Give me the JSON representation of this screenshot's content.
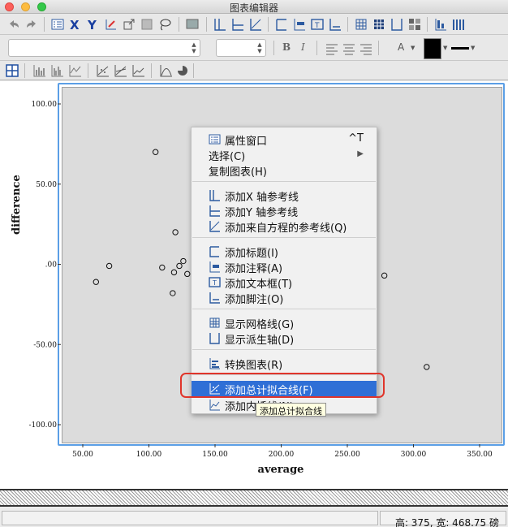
{
  "window": {
    "title": "图表编辑器"
  },
  "chart_data": {
    "type": "scatter",
    "xlabel": "average",
    "ylabel": "difference",
    "xlim": [
      30,
      360
    ],
    "ylim": [
      -115,
      115
    ],
    "x_ticks": [
      50,
      100,
      150,
      200,
      250,
      300,
      350
    ],
    "x_tick_labels": [
      "50.00",
      "100.00",
      "150.00",
      "200.00",
      "250.00",
      "300.00",
      "350.00"
    ],
    "y_ticks": [
      100,
      50,
      0,
      -50,
      -100
    ],
    "y_tick_labels": [
      "100.00",
      "50.00",
      ".00",
      "-50.00",
      "-100.00"
    ],
    "grid": false,
    "points": [
      {
        "x": 105,
        "y": 70
      },
      {
        "x": 120,
        "y": 20
      },
      {
        "x": 60,
        "y": -11
      },
      {
        "x": 70,
        "y": -1
      },
      {
        "x": 110,
        "y": -2
      },
      {
        "x": 118,
        "y": -18
      },
      {
        "x": 119,
        "y": -5
      },
      {
        "x": 123,
        "y": -1
      },
      {
        "x": 126,
        "y": 2
      },
      {
        "x": 129,
        "y": -6
      },
      {
        "x": 278,
        "y": -7
      },
      {
        "x": 310,
        "y": -64
      }
    ]
  },
  "context_menu": {
    "items": [
      {
        "label": "属性窗口",
        "shortcut": "^T",
        "icon": "properties-icon"
      },
      {
        "label": "选择(C)",
        "submenu": "▶"
      },
      {
        "label": "复制图表(H)"
      },
      {
        "label": "添加X 轴参考线",
        "icon": "x-refline-icon"
      },
      {
        "label": "添加Y 轴参考线",
        "icon": "y-refline-icon"
      },
      {
        "label": "添加来自方程的参考线(Q)",
        "icon": "equation-line-icon"
      },
      {
        "label": "添加标题(I)",
        "icon": "title-icon"
      },
      {
        "label": "添加注释(A)",
        "icon": "annotation-icon"
      },
      {
        "label": "添加文本框(T)",
        "icon": "textbox-icon"
      },
      {
        "label": "添加脚注(O)",
        "icon": "footnote-icon"
      },
      {
        "label": "显示网格线(G)",
        "icon": "gridlines-icon"
      },
      {
        "label": "显示派生轴(D)",
        "icon": "derived-axis-icon"
      },
      {
        "label": "转换图表(R)",
        "icon": "transform-chart-icon"
      },
      {
        "label": "添加总计拟合线(F)",
        "icon": "fit-line-icon",
        "selected": true
      },
      {
        "label": "添加内插线(N)",
        "icon": "interpolation-line-icon"
      }
    ],
    "tooltip": "添加总计拟合线"
  },
  "format_toolbar": {
    "bold": "B",
    "italic": "I",
    "text_color_label": "A"
  },
  "statusbar": {
    "text": "高: 375, 宽: 468.75 磅"
  },
  "colors": {
    "selection": "#2f6fd6",
    "highlight_ring": "#e0352b",
    "frame": "#5b9fe6",
    "plot_bg": "#dcdcdc"
  }
}
